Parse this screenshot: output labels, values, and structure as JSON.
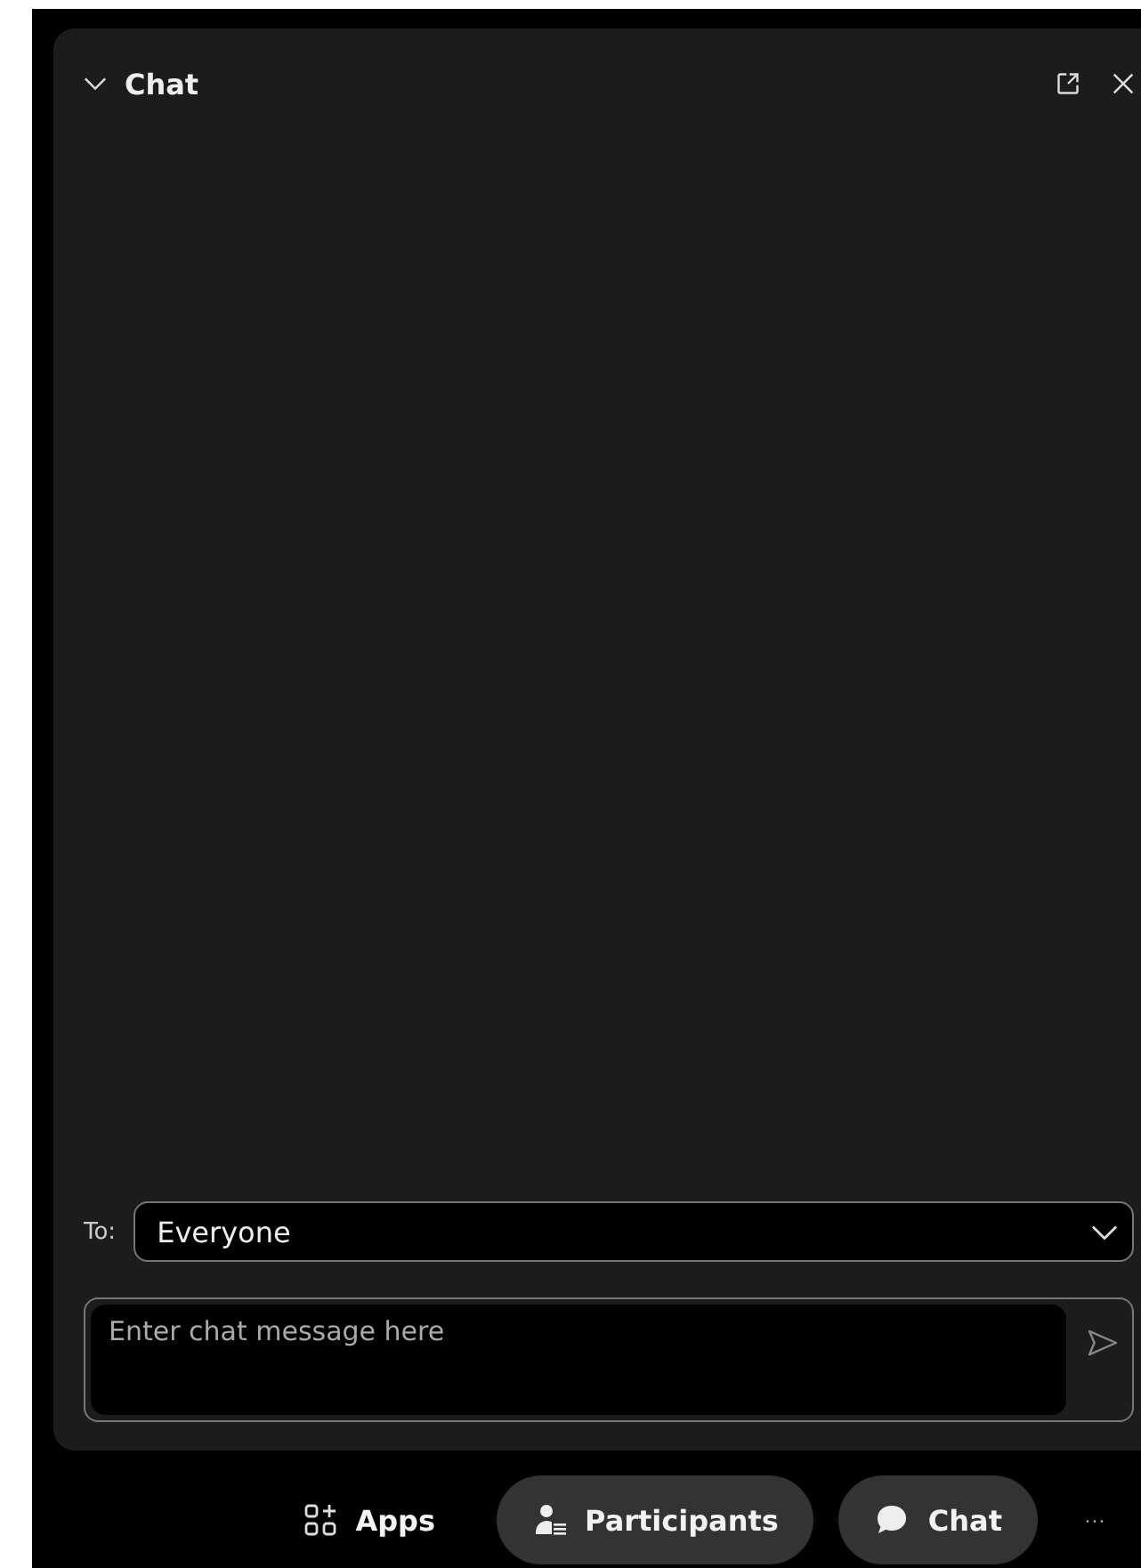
{
  "panel": {
    "title": "Chat"
  },
  "recipient": {
    "label": "To:",
    "value": "Everyone"
  },
  "message": {
    "placeholder": "Enter chat message here"
  },
  "toolbar": [
    {
      "kind": "apps",
      "label": "Apps",
      "active": false
    },
    {
      "kind": "participants",
      "label": "Participants",
      "active": true
    },
    {
      "kind": "chat",
      "label": "Chat",
      "active": true
    }
  ],
  "more": "···"
}
